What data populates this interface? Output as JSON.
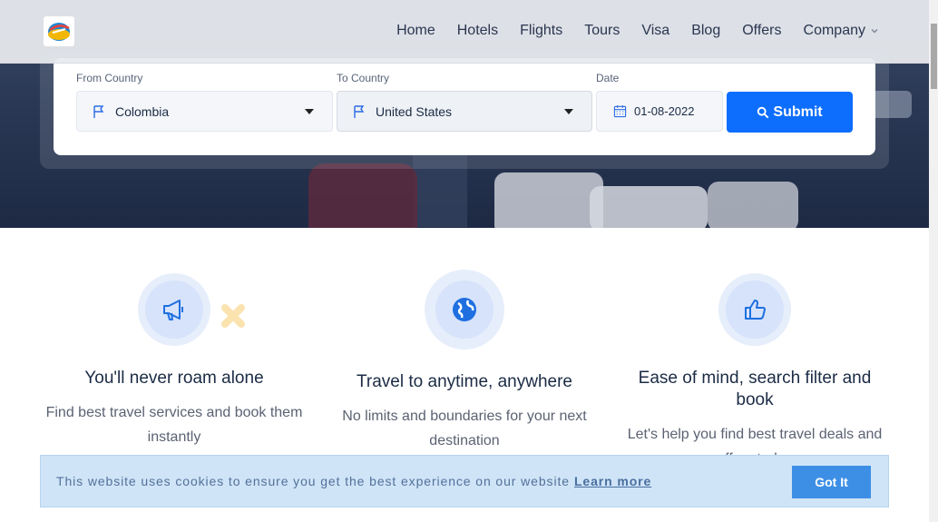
{
  "nav": {
    "items": [
      {
        "label": "Home"
      },
      {
        "label": "Hotels"
      },
      {
        "label": "Flights"
      },
      {
        "label": "Tours"
      },
      {
        "label": "Visa"
      },
      {
        "label": "Blog"
      },
      {
        "label": "Offers"
      },
      {
        "label": "Company"
      }
    ]
  },
  "search": {
    "from_label": "From Country",
    "from_value": "Colombia",
    "to_label": "To Country",
    "to_value": "United States",
    "date_label": "Date",
    "date_value": "01-08-2022",
    "submit_label": "Submit"
  },
  "features": [
    {
      "icon": "megaphone-icon",
      "title": "You'll never roam alone",
      "desc": "Find best travel services and book them instantly"
    },
    {
      "icon": "globe-icon",
      "title": "Travel to anytime, anywhere",
      "desc": "No limits and boundaries for your next destination"
    },
    {
      "icon": "thumbs-up-icon",
      "title": "Ease of mind, search filter and book",
      "desc": "Let's help you find best travel deals and offers today"
    }
  ],
  "cookie": {
    "text": "This website uses cookies to ensure you get the best experience on our website",
    "link": "Learn more",
    "button": "Got It"
  },
  "colors": {
    "primary": "#0d6efd",
    "cookie_bg": "#cfe4f7",
    "icon_ring": "#e6eefb"
  }
}
